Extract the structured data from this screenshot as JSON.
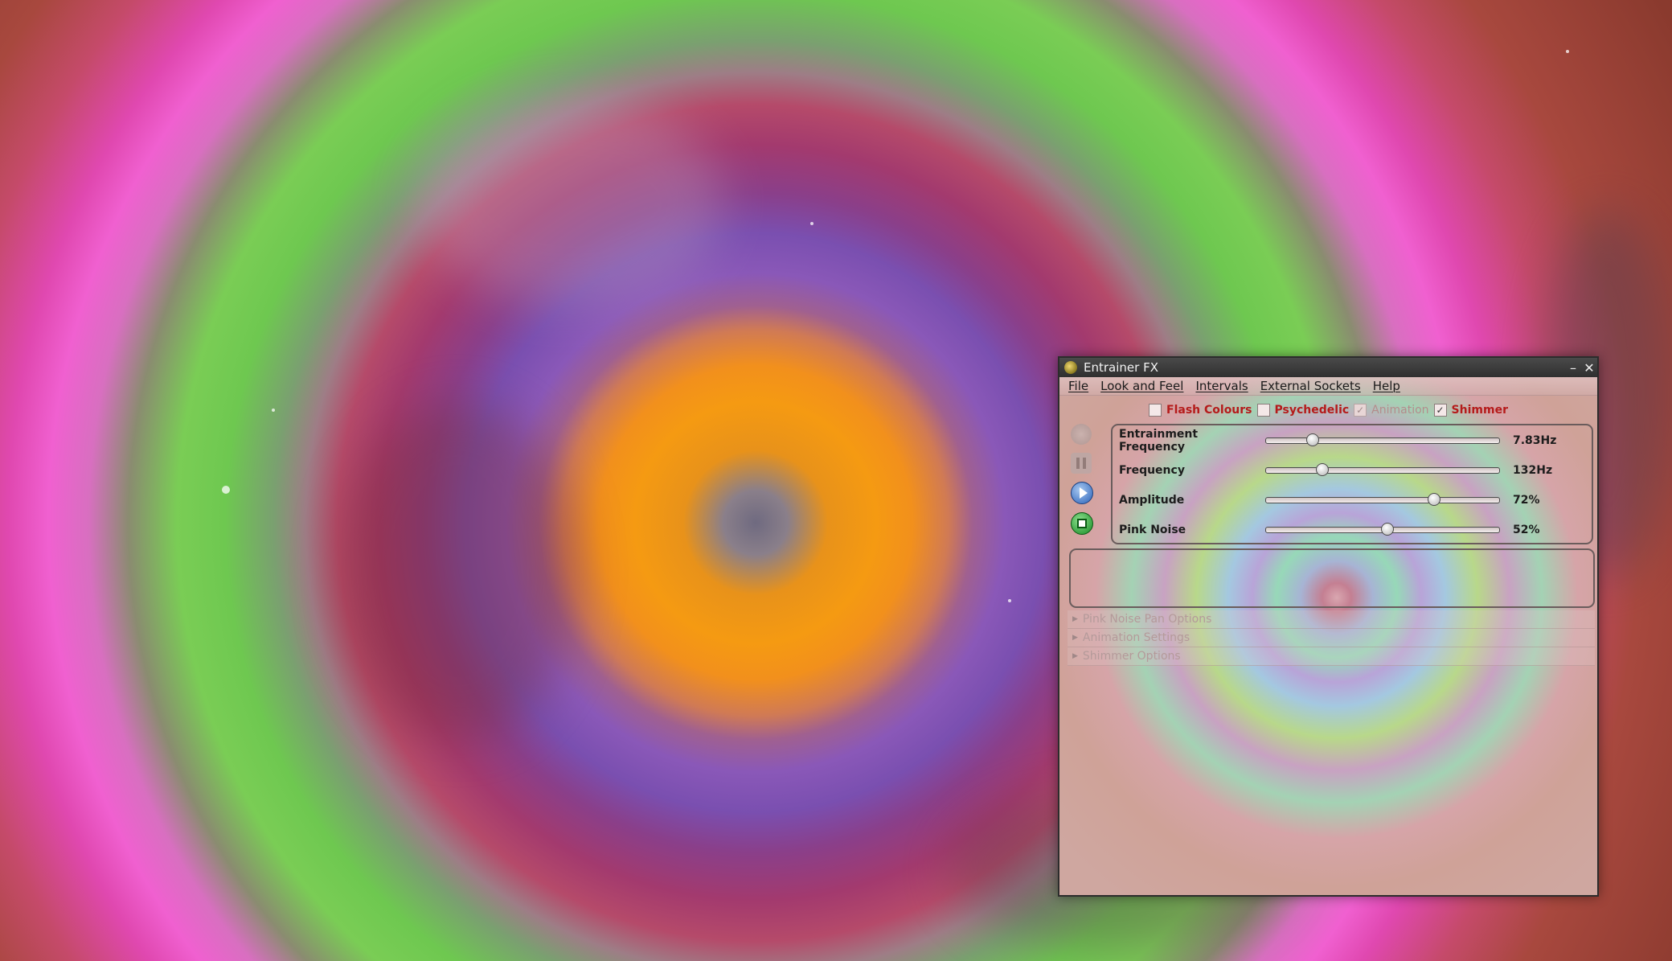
{
  "window": {
    "title": "Entrainer FX",
    "minimize_glyph": "–",
    "close_glyph": "✕"
  },
  "menu": [
    "File",
    "Look and Feel",
    "Intervals",
    "External Sockets",
    "Help"
  ],
  "checkboxes": [
    {
      "label": "Flash Colours",
      "checked": false,
      "enabled": true
    },
    {
      "label": "Psychedelic",
      "checked": false,
      "enabled": true
    },
    {
      "label": "Animation",
      "checked": true,
      "enabled": false
    },
    {
      "label": "Shimmer",
      "checked": true,
      "enabled": true
    }
  ],
  "controls": [
    "record-icon",
    "pause-icon",
    "play-icon",
    "stop-icon"
  ],
  "sliders": [
    {
      "label": "Entrainment Frequency",
      "value_text": "7.83Hz",
      "level": 0.2
    },
    {
      "label": "Frequency",
      "value_text": "132Hz",
      "level": 0.24
    },
    {
      "label": "Amplitude",
      "value_text": "72%",
      "level": 0.72
    },
    {
      "label": "Pink Noise",
      "value_text": "52%",
      "level": 0.52
    }
  ],
  "sections": [
    "Pink Noise Pan Options",
    "Animation Settings",
    "Shimmer Options"
  ]
}
